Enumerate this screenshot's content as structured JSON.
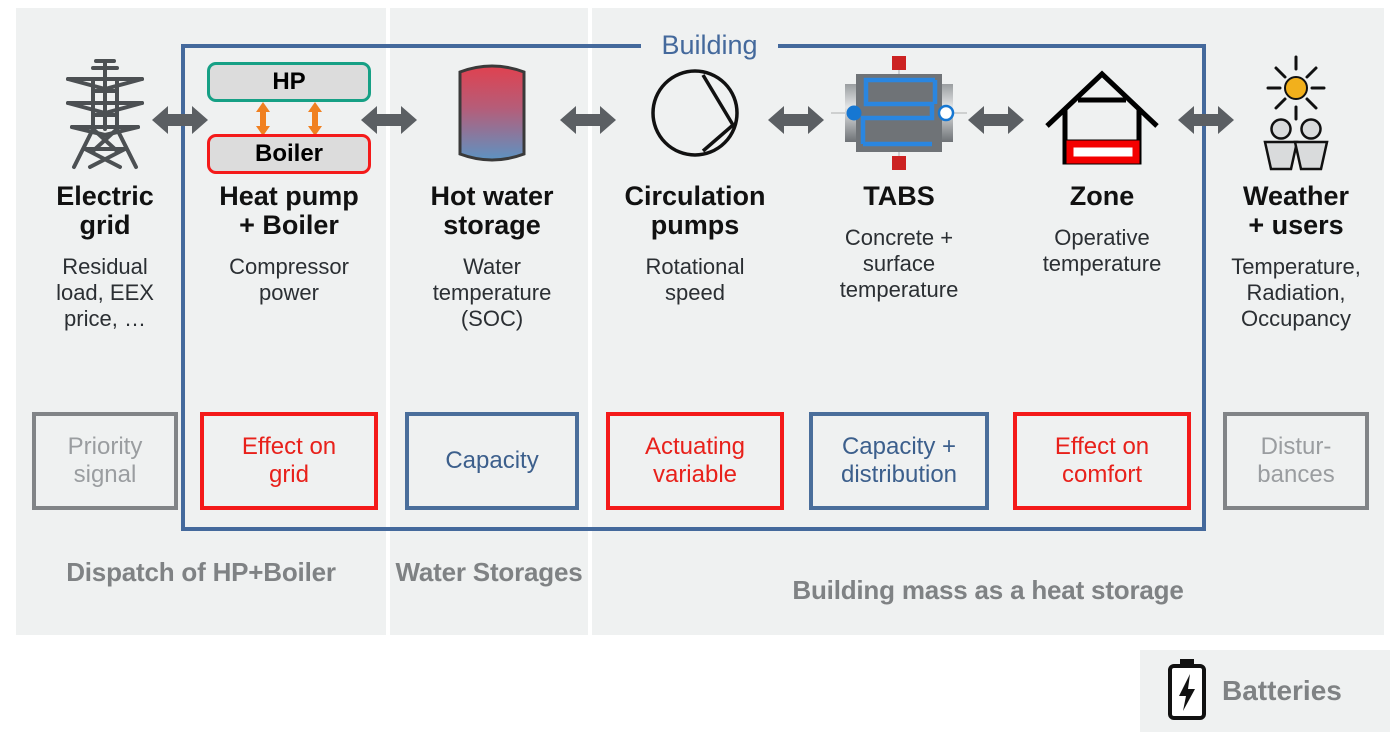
{
  "building": {
    "label": "Building"
  },
  "groups": [
    {
      "id": "dispatch",
      "label": "Dispatch of\nHP+Boiler"
    },
    {
      "id": "water",
      "label": "Water\nStorages"
    },
    {
      "id": "mass",
      "label": "Building mass as a heat storage"
    }
  ],
  "columns": [
    {
      "icon": "electric-tower-icon",
      "title": "Electric\ngrid",
      "subtitle": "Residual\nload, EEX\nprice, …",
      "tag": {
        "text": "Priority\nsignal",
        "style": "gray"
      }
    },
    {
      "icon": "heatpump-boiler-icon",
      "title": "Heat pump\n+ Boiler",
      "subtitle": "Compressor\npower",
      "tag": {
        "text": "Effect on\ngrid",
        "style": "red"
      },
      "hp_label": "HP",
      "boiler_label": "Boiler"
    },
    {
      "icon": "water-tank-icon",
      "title": "Hot water\nstorage",
      "subtitle": "Water\ntemperature\n(SOC)",
      "tag": {
        "text": "Capacity",
        "style": "blue"
      }
    },
    {
      "icon": "pump-icon",
      "title": "Circulation\npumps",
      "subtitle": "Rotational\nspeed",
      "tag": {
        "text": "Actuating\nvariable",
        "style": "red"
      }
    },
    {
      "icon": "tabs-icon",
      "title": "TABS",
      "subtitle": "Concrete +\nsurface\ntemperature",
      "tag": {
        "text": "Capacity +\ndistribution",
        "style": "blue"
      }
    },
    {
      "icon": "house-icon",
      "title": "Zone",
      "subtitle": "Operative\ntemperature",
      "tag": {
        "text": "Effect on\ncomfort",
        "style": "red"
      }
    },
    {
      "icon": "weather-users-icon",
      "title": "Weather\n+ users",
      "subtitle": "Temperature,\nRadiation,\nOccupancy",
      "tag": {
        "text": "Distur-\nbances",
        "style": "gray"
      }
    }
  ],
  "batteries": {
    "label": "Batteries",
    "icon": "battery-icon"
  },
  "colors": {
    "panel_bg": "#eff1f1",
    "building_border": "#44699c",
    "red": "#f41a1a",
    "blue": "#4a6e9b",
    "gray": "#888888",
    "teal": "#16a085",
    "orange": "#f08020",
    "arrow_gray": "#5b5f63"
  }
}
